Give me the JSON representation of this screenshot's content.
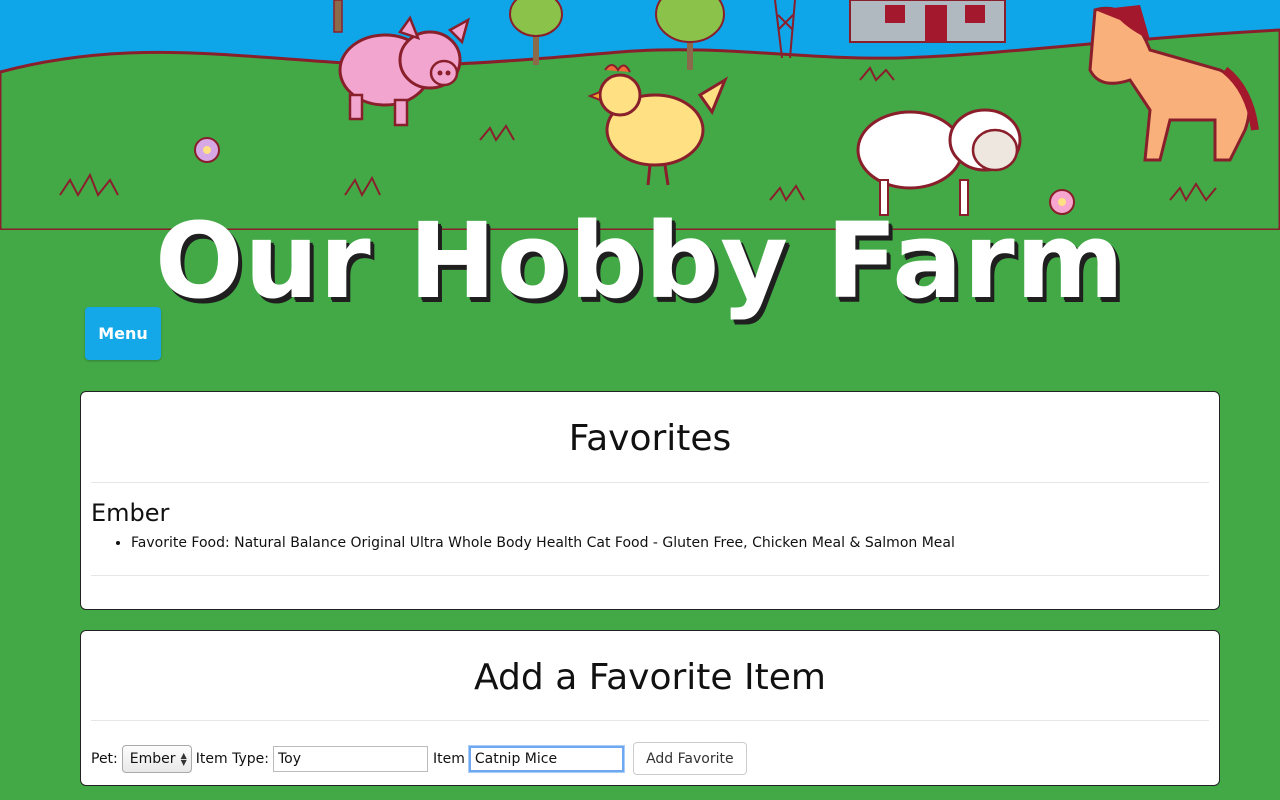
{
  "header": {
    "site_title": "Our Hobby Farm",
    "menu_label": "Menu"
  },
  "favorites": {
    "title": "Favorites",
    "pets": [
      {
        "name": "Ember",
        "items": [
          "Favorite Food: Natural Balance Original Ultra Whole Body Health Cat Food - Gluten Free, Chicken Meal & Salmon Meal"
        ]
      }
    ]
  },
  "add_form": {
    "title": "Add a Favorite Item",
    "pet_label": "Pet:",
    "pet_selected": "Ember",
    "item_type_label": "Item Type:",
    "item_type_value": "Toy",
    "item_label": "Item",
    "item_value": "Catnip Mice",
    "submit_label": "Add Favorite"
  },
  "colors": {
    "grass": "#43a947",
    "sky": "#0ea5e9",
    "menu_button": "#14a8e8"
  }
}
